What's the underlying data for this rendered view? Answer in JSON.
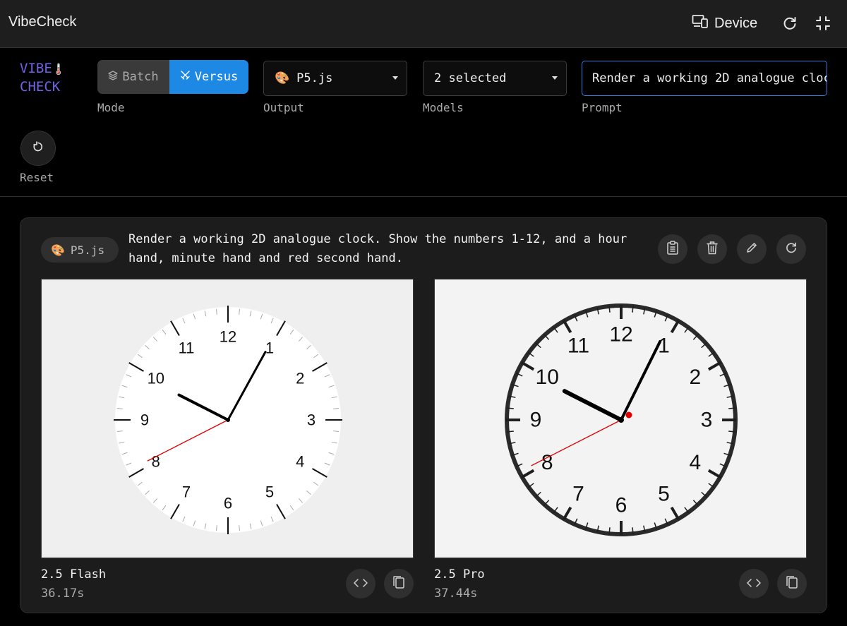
{
  "app": {
    "title": "VibeCheck",
    "device_label": "Device"
  },
  "logo": {
    "line1": "VIBE",
    "line2": "CHECK",
    "thermometer": "🌡️"
  },
  "mode": {
    "label": "Mode",
    "options": [
      "Batch",
      "Versus"
    ],
    "selected": "Versus"
  },
  "output": {
    "label": "Output",
    "icon": "🎨",
    "value": "P5.js"
  },
  "models": {
    "label": "Models",
    "value": "2 selected"
  },
  "prompt_field": {
    "label": "Prompt",
    "value": "Render a working 2D analogue clock. Show the numbers 1-12, and a hour hand, minute hand and red second hand."
  },
  "reset": {
    "label": "Reset"
  },
  "card": {
    "chip_icon": "🎨",
    "chip_label": "P5.js",
    "prompt": "Render a working 2D analogue clock. Show the numbers 1-12, and a hour hand, minute hand and red second hand.",
    "results": [
      {
        "model": "2.5 Flash",
        "time": "36.17s",
        "clock": {
          "numbers": [
            "12",
            "1",
            "2",
            "3",
            "4",
            "5",
            "6",
            "7",
            "8",
            "9",
            "10",
            "11"
          ],
          "hour": 9.9,
          "minute": 4.8,
          "second": 40.5
        }
      },
      {
        "model": "2.5 Pro",
        "time": "37.44s",
        "clock": {
          "numbers": [
            "12",
            "1",
            "2",
            "3",
            "4",
            "5",
            "6",
            "7",
            "8",
            "9",
            "10",
            "11"
          ],
          "hour": 9.9,
          "minute": 4.4,
          "second": 40.5
        }
      }
    ]
  },
  "colors": {
    "accent": "#1e88e5",
    "logo": "#6f63e6",
    "second_hand": "#e00000"
  }
}
